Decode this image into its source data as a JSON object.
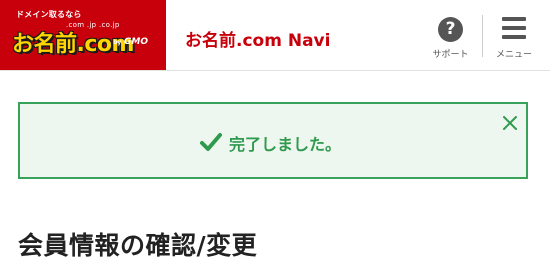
{
  "header": {
    "logo": {
      "tagline": "ドメイン取るなら",
      "domains": ".com .jp .co.jp",
      "brand": "お名前.com",
      "by": "by",
      "company": "GMO"
    },
    "site_title": "お名前.com Navi",
    "support": {
      "icon": "question-circle-icon",
      "label": "サポート"
    },
    "menu": {
      "icon": "hamburger-menu-icon",
      "label": "メニュー"
    },
    "brand_color": "#c8000b"
  },
  "alert": {
    "type": "success",
    "icon": "checkmark-icon",
    "message": "完了しました。",
    "close_icon": "close-icon",
    "color": "#39a25a"
  },
  "page": {
    "title": "会員情報の確認/変更"
  }
}
